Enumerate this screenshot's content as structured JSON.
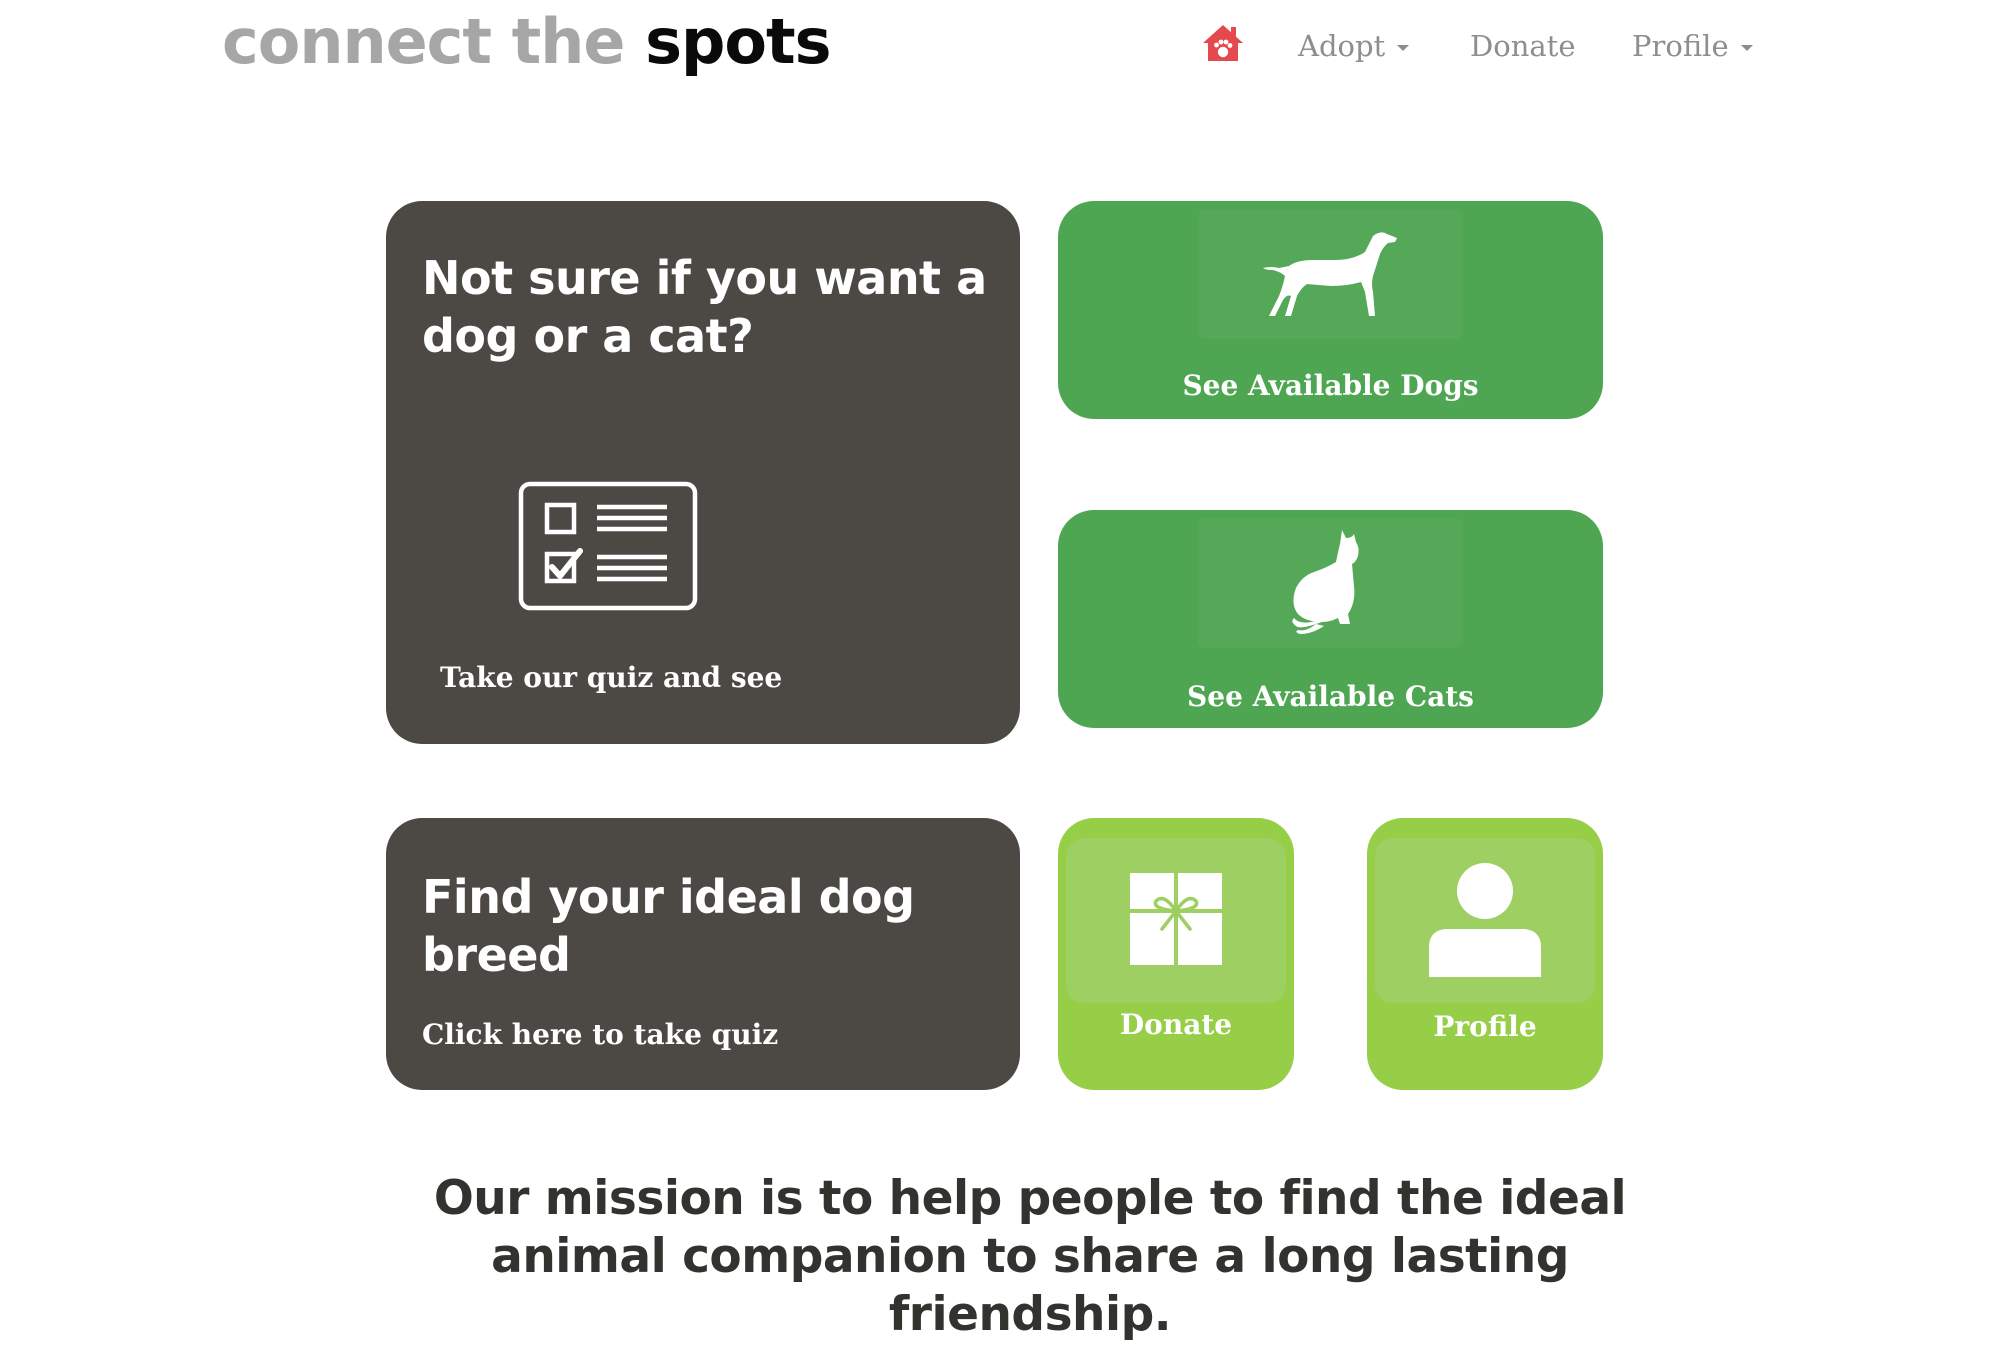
{
  "brand": {
    "light": "connect the",
    "dark": "spots"
  },
  "nav": {
    "home_icon": "home-paw-icon",
    "adopt": "Adopt",
    "donate": "Donate",
    "profile": "Profile"
  },
  "tiles": {
    "quiz": {
      "heading": "Not sure if you want a dog or a cat?",
      "subtext": "Take our quiz and see",
      "icon": "checklist-icon"
    },
    "dogs": {
      "label": "See Available Dogs",
      "icon": "dog-icon"
    },
    "cats": {
      "label": "See Available Cats",
      "icon": "cat-icon"
    },
    "breed": {
      "heading": "Find your ideal dog breed",
      "subtext": "Click here to take quiz"
    },
    "donate": {
      "label": "Donate",
      "icon": "gift-icon"
    },
    "profile": {
      "label": "Profile",
      "icon": "person-icon"
    }
  },
  "mission": "Our mission is to help people to find the ideal animal companion to share a long lasting friendship.",
  "colors": {
    "dark_tile": "#4c4945",
    "green_tile": "#4fa652",
    "lime_tile": "#97ce48",
    "home_icon": "#e5484d",
    "nav_text": "#8e8e8e"
  }
}
